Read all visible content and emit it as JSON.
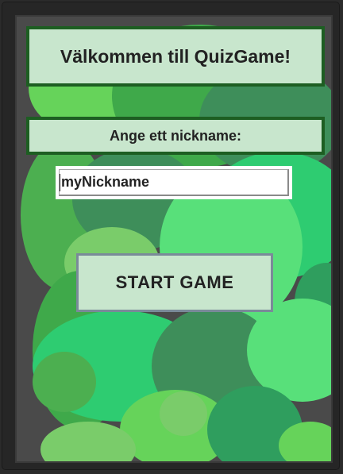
{
  "title": "Välkommen till QuizGame!",
  "nickname_prompt": "Ange ett nickname:",
  "nickname_input": {
    "value": "myNickname"
  },
  "start_button_label": "START GAME",
  "colors": {
    "panel_background": "#c8e6cd",
    "panel_border": "#1d5e22",
    "button_border": "#7a8a99",
    "bubble_palette": [
      "#4caf50",
      "#66d35a",
      "#2ecc71",
      "#3e8e5a",
      "#58e07a",
      "#3fa94a",
      "#7acc6a",
      "#2f9e5e"
    ]
  }
}
